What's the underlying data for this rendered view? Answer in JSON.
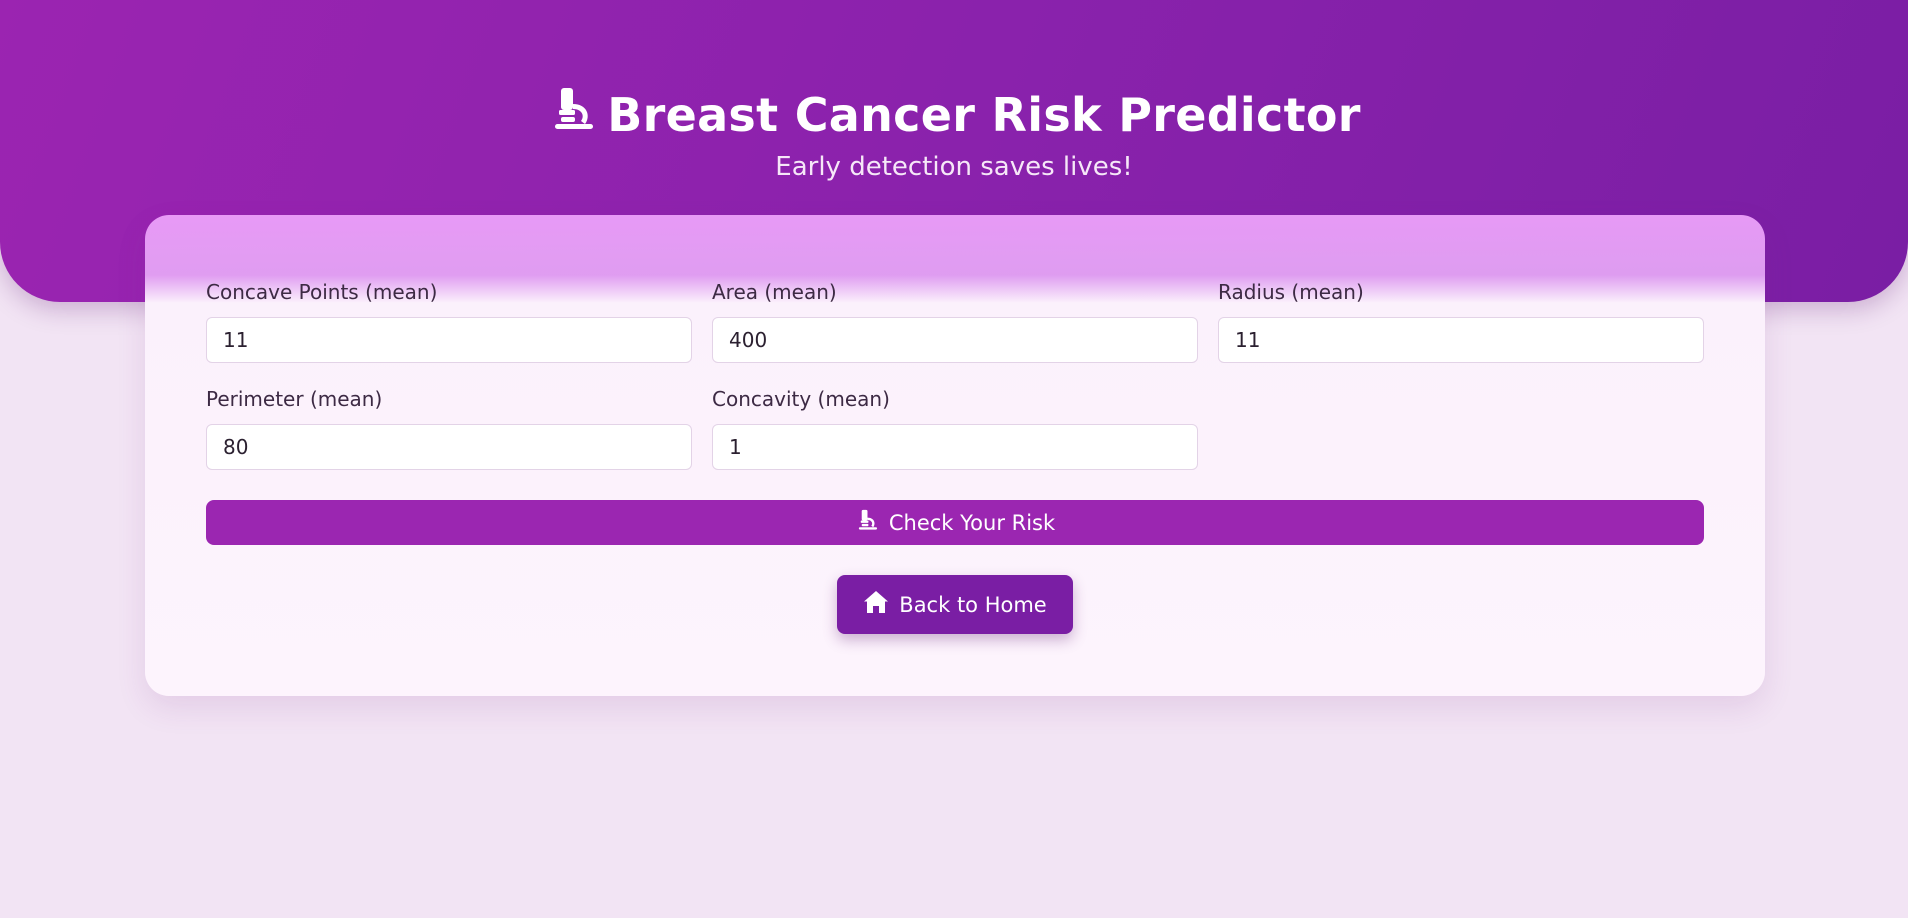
{
  "header": {
    "title": "Breast Cancer Risk Predictor",
    "title_icon": "microscope-icon",
    "subtitle": "Early detection saves lives!"
  },
  "form": {
    "fields": [
      {
        "label": "Concave Points (mean)",
        "value": "11"
      },
      {
        "label": "Area (mean)",
        "value": "400"
      },
      {
        "label": "Radius (mean)",
        "value": "11"
      },
      {
        "label": "Perimeter (mean)",
        "value": "80"
      },
      {
        "label": "Concavity (mean)",
        "value": "1"
      }
    ],
    "submit_label": "Check Your Risk",
    "submit_icon": "microscope-icon"
  },
  "navigation": {
    "home_label": "Back to Home",
    "home_icon": "home-icon"
  },
  "colors": {
    "primary": "#9b26b1",
    "primary_dark": "#7a1ea4",
    "background": "#f2e4f4"
  }
}
